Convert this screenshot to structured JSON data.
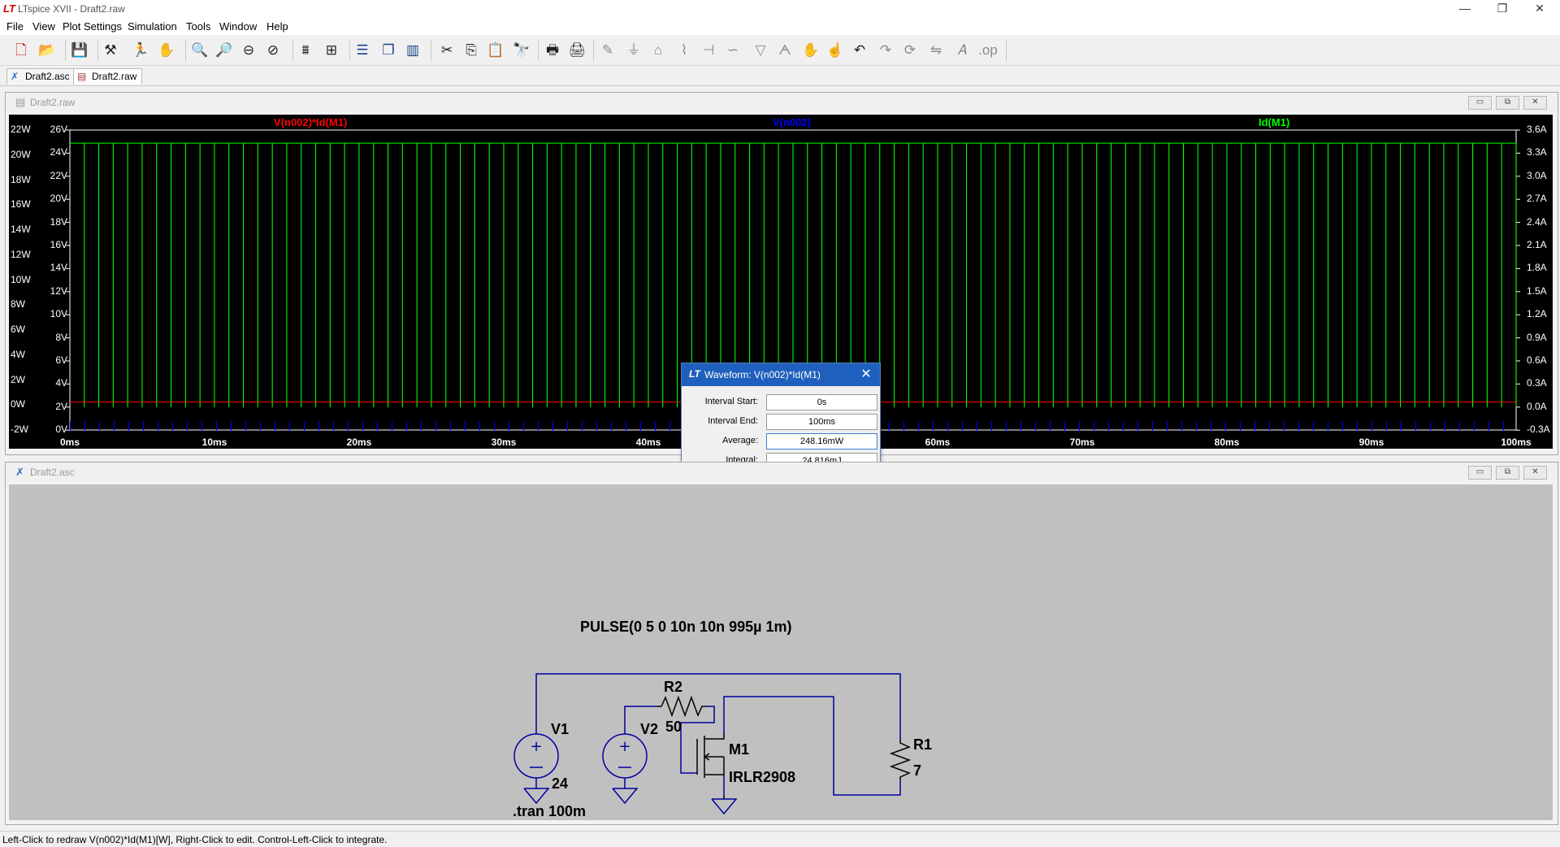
{
  "app": {
    "title": "LTspice XVII - Draft2.raw"
  },
  "menu": {
    "items": [
      "File",
      "View",
      "Plot Settings",
      "Simulation",
      "Tools",
      "Window",
      "Help"
    ]
  },
  "toolbar": {
    "icons": [
      "new-schematic",
      "open",
      "save",
      "control-panel",
      "run",
      "pan",
      "zoom-in",
      "zoom-area",
      "zoom-out",
      "zoom-fit",
      "autorange",
      "manual-limits",
      "tile-horizontal",
      "cascade",
      "tile-vertical",
      "cut",
      "copy",
      "paste",
      "find",
      "print-setup",
      "print",
      "draw-wire",
      "ground",
      "label-net",
      "resistor",
      "capacitor",
      "inductor",
      "diode",
      "component",
      "move",
      "drag",
      "undo",
      "redo",
      "rotate",
      "mirror",
      "text",
      "spice-directive"
    ]
  },
  "tabs": [
    {
      "label": "Draft2.asc"
    },
    {
      "label": "Draft2.raw"
    }
  ],
  "plot_window": {
    "title": "Draft2.raw",
    "traces": [
      "V(n002)*Id(M1)",
      "V(n002)",
      "Id(M1)"
    ],
    "left_axis_w": [
      "22W",
      "20W",
      "18W",
      "16W",
      "14W",
      "12W",
      "10W",
      "8W",
      "6W",
      "4W",
      "2W",
      "0W",
      "-2W"
    ],
    "left_axis_v": [
      "26V",
      "24V",
      "22V",
      "20V",
      "18V",
      "16V",
      "14V",
      "12V",
      "10V",
      "8V",
      "6V",
      "4V",
      "2V",
      "0V"
    ],
    "right_axis": [
      "3.6A",
      "3.3A",
      "3.0A",
      "2.7A",
      "2.4A",
      "2.1A",
      "1.8A",
      "1.5A",
      "1.2A",
      "0.9A",
      "0.6A",
      "0.3A",
      "0.0A",
      "-0.3A"
    ],
    "x_axis": [
      "0ms",
      "10ms",
      "20ms",
      "30ms",
      "40ms",
      "50ms",
      "60ms",
      "70ms",
      "80ms",
      "90ms",
      "100ms"
    ]
  },
  "chart_data": {
    "type": "line",
    "xlabel": "",
    "ylabel": "",
    "xlim": [
      0,
      100
    ],
    "x_unit": "ms",
    "series": [
      {
        "name": "V(n002)*Id(M1)",
        "color": "#ff0000",
        "axis": "W",
        "description_values": {
          "low": 0,
          "high": 0
        }
      },
      {
        "name": "V(n002)",
        "color": "#0000ff",
        "axis": "V",
        "low": 0,
        "high": 24
      },
      {
        "name": "Id(M1)",
        "color": "#00ff00",
        "axis": "A",
        "low": 0.0,
        "high": 3.43,
        "period_ms": 1,
        "pulse_ms": 0.995
      }
    ]
  },
  "dialog": {
    "title": "Waveform: V(n002)*Id(M1)",
    "fields": [
      {
        "label": "Interval Start:",
        "value": "0s"
      },
      {
        "label": "Interval End:",
        "value": "100ms"
      },
      {
        "label": "Average:",
        "value": "248.16mW"
      },
      {
        "label": "Integral:",
        "value": "24.816mJ"
      }
    ]
  },
  "schematic_window": {
    "title": "Draft2.asc",
    "pulse": "PULSE(0 5 0 10n 10n 995µ 1m)",
    "v1_name": "V1",
    "v1_value": "24",
    "v2_name": "V2",
    "r2_name": "R2",
    "r2_value": "50",
    "m1_name": "M1",
    "m1_model": "IRLR2908",
    "r1_name": "R1",
    "r1_value": "7",
    "directive": ".tran 100m"
  },
  "status": {
    "text": "Left-Click to redraw V(n002)*Id(M1)[W],  Right-Click to edit. Control-Left-Click to integrate."
  },
  "colors": {
    "wire": "#0000a0",
    "trace_power": "#ff0000",
    "trace_voltage": "#0000ff",
    "trace_current": "#00ff00"
  }
}
